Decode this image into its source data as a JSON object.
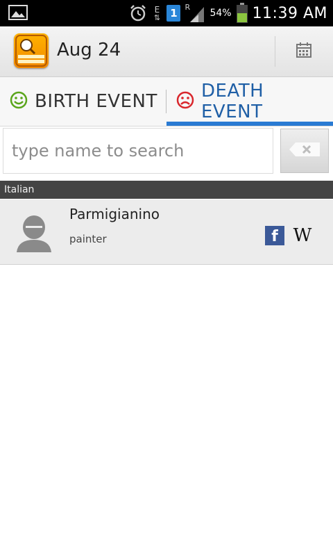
{
  "status_bar": {
    "signal_letter_e": "E",
    "sim_badge": "1",
    "roaming_letter": "R",
    "battery_percent": "54%",
    "time": "11:39 AM",
    "icons": [
      "image-icon",
      "alarm-icon",
      "data-arrows-icon",
      "sim-icon",
      "signal-icon",
      "battery-icon"
    ]
  },
  "action_bar": {
    "title": "Aug 24",
    "icons": [
      "app-logo-icon",
      "calendar-icon"
    ]
  },
  "tabs": [
    {
      "label": "BIRTH EVENT",
      "icon": "smile-icon",
      "icon_color": "#5aa51b",
      "selected": false
    },
    {
      "label": "DEATH EVENT",
      "icon": "sad-icon",
      "icon_color": "#d9262c",
      "selected": true
    }
  ],
  "search": {
    "placeholder": "type name to search",
    "value": ""
  },
  "section": {
    "header": "Italian"
  },
  "list": [
    {
      "name": "Parmigianino",
      "description": "painter",
      "icons": [
        "avatar-placeholder-icon",
        "facebook-icon",
        "wikipedia-icon"
      ]
    }
  ],
  "colors": {
    "accent": "#2a7bd3",
    "death_tab_text": "#1f5fa6",
    "facebook": "#3b5998"
  }
}
